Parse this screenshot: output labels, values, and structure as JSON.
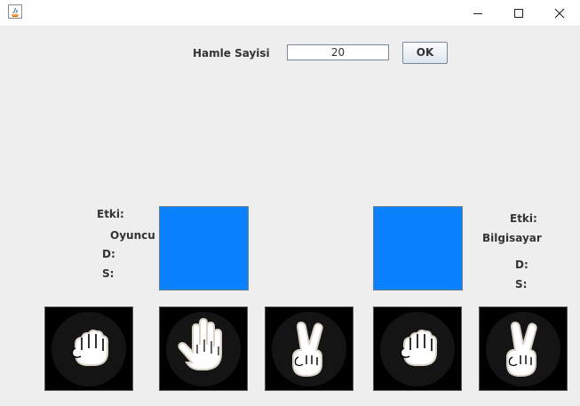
{
  "window": {
    "app_icon": "java-icon",
    "controls": [
      "minimize-icon",
      "maximize-icon",
      "close-icon"
    ]
  },
  "header": {
    "moves_label": "Hamle Sayisi",
    "moves_value": "20",
    "ok_label": "OK"
  },
  "player": {
    "effect_label": "Etki:",
    "name": "Oyuncu",
    "d_label": "D:",
    "s_label": "S:",
    "slot_color": "#0a82ff"
  },
  "computer": {
    "effect_label": "Etki:",
    "name": "Bilgisayar",
    "d_label": "D:",
    "s_label": "S:",
    "slot_color": "#0a82ff"
  },
  "cards": [
    {
      "icon": "rock-hand-icon"
    },
    {
      "icon": "paper-hand-icon"
    },
    {
      "icon": "scissors-hand-icon"
    },
    {
      "icon": "rock-hand-icon"
    },
    {
      "icon": "scissors-hand-icon"
    }
  ]
}
